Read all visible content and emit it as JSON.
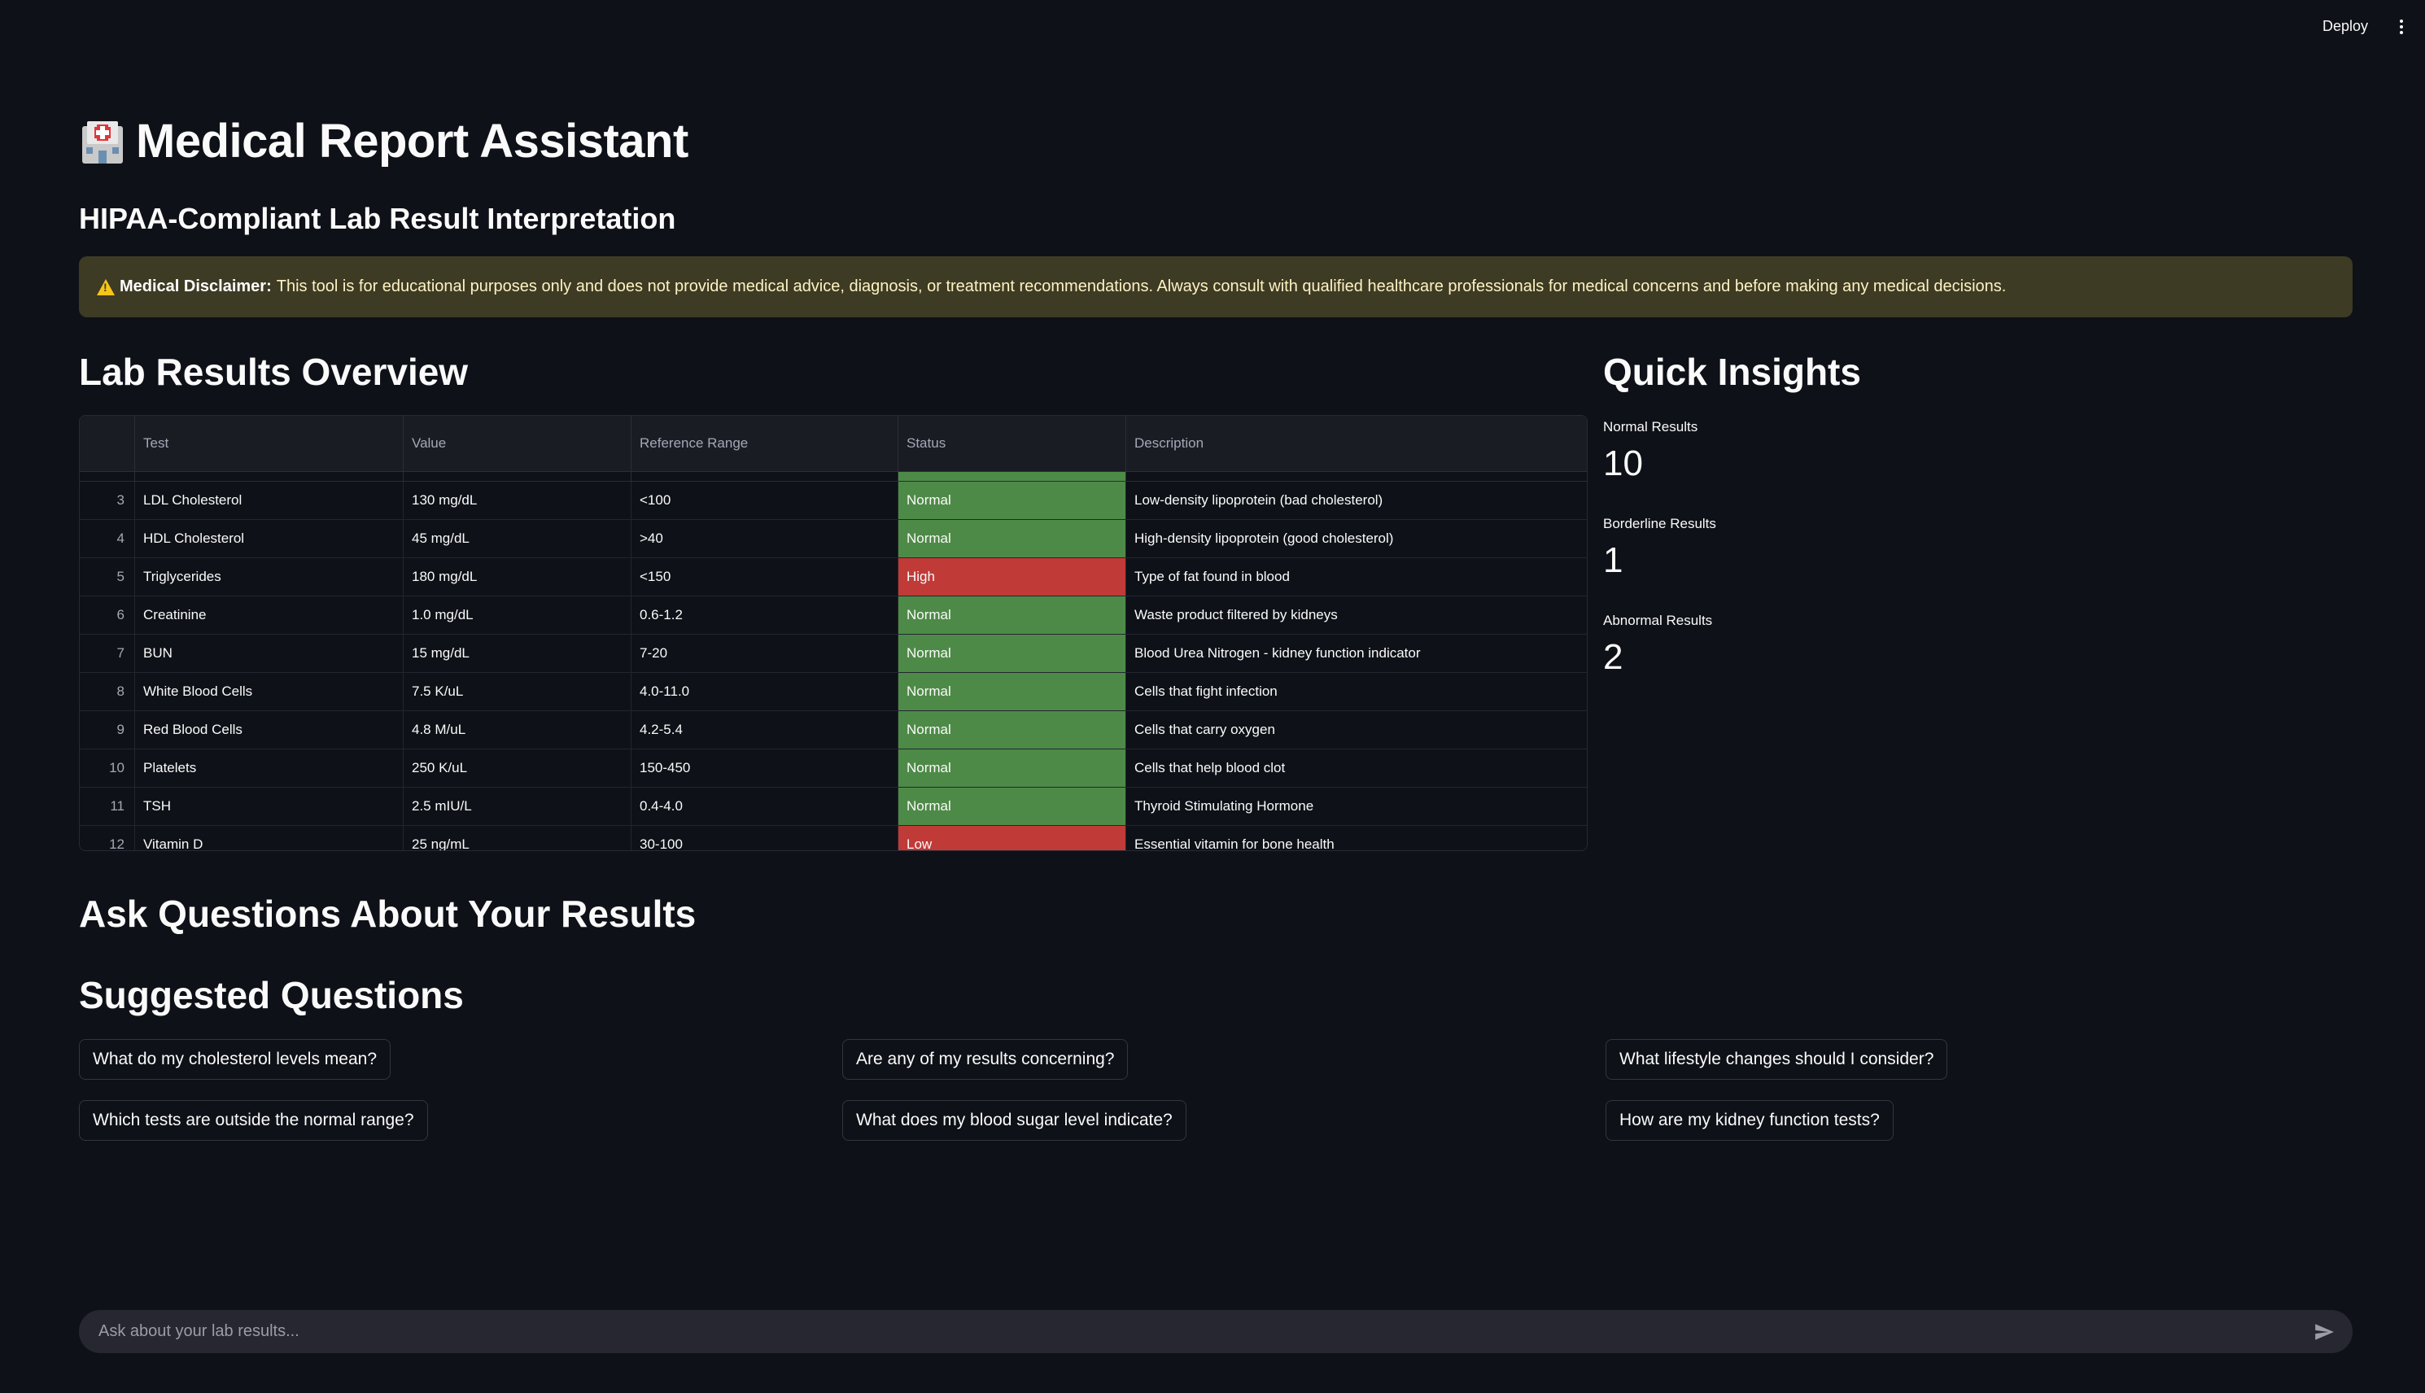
{
  "header": {
    "deploy_label": "Deploy",
    "menu_icon": "kebab-menu-icon"
  },
  "page": {
    "title": "Medical Report Assistant",
    "title_icon": "hospital-icon",
    "subtitle": "HIPAA-Compliant Lab Result Interpretation"
  },
  "disclaimer": {
    "icon": "warning-icon",
    "label": "Medical Disclaimer:",
    "text": "This tool is for educational purposes only and does not provide medical advice, diagnosis, or treatment recommendations. Always consult with qualified healthcare professionals for medical concerns and before making any medical decisions."
  },
  "lab_results": {
    "heading": "Lab Results Overview",
    "columns": [
      "",
      "Test",
      "Value",
      "Reference Range",
      "Status",
      "Description"
    ],
    "rows": [
      {
        "index": "3",
        "test": "LDL Cholesterol",
        "value": "130 mg/dL",
        "range": "<100",
        "status": "Normal",
        "description": "Low-density lipoprotein (bad cholesterol)"
      },
      {
        "index": "4",
        "test": "HDL Cholesterol",
        "value": "45 mg/dL",
        "range": ">40",
        "status": "Normal",
        "description": "High-density lipoprotein (good cholesterol)"
      },
      {
        "index": "5",
        "test": "Triglycerides",
        "value": "180 mg/dL",
        "range": "<150",
        "status": "High",
        "description": "Type of fat found in blood"
      },
      {
        "index": "6",
        "test": "Creatinine",
        "value": "1.0 mg/dL",
        "range": "0.6-1.2",
        "status": "Normal",
        "description": "Waste product filtered by kidneys"
      },
      {
        "index": "7",
        "test": "BUN",
        "value": "15 mg/dL",
        "range": "7-20",
        "status": "Normal",
        "description": "Blood Urea Nitrogen - kidney function indicator"
      },
      {
        "index": "8",
        "test": "White Blood Cells",
        "value": "7.5 K/uL",
        "range": "4.0-11.0",
        "status": "Normal",
        "description": "Cells that fight infection"
      },
      {
        "index": "9",
        "test": "Red Blood Cells",
        "value": "4.8 M/uL",
        "range": "4.2-5.4",
        "status": "Normal",
        "description": "Cells that carry oxygen"
      },
      {
        "index": "10",
        "test": "Platelets",
        "value": "250 K/uL",
        "range": "150-450",
        "status": "Normal",
        "description": "Cells that help blood clot"
      },
      {
        "index": "11",
        "test": "TSH",
        "value": "2.5 mIU/L",
        "range": "0.4-4.0",
        "status": "Normal",
        "description": "Thyroid Stimulating Hormone"
      },
      {
        "index": "12",
        "test": "Vitamin D",
        "value": "25 ng/mL",
        "range": "30-100",
        "status": "Low",
        "description": "Essential vitamin for bone health"
      }
    ]
  },
  "insights": {
    "heading": "Quick Insights",
    "metrics": [
      {
        "label": "Normal Results",
        "value": "10"
      },
      {
        "label": "Borderline Results",
        "value": "1"
      },
      {
        "label": "Abnormal Results",
        "value": "2"
      }
    ]
  },
  "questions": {
    "heading": "Ask Questions About Your Results",
    "suggested_heading": "Suggested Questions",
    "items": [
      "What do my cholesterol levels mean?",
      "Are any of my results concerning?",
      "What lifestyle changes should I consider?",
      "Which tests are outside the normal range?",
      "What does my blood sugar level indicate?",
      "How are my kidney function tests?"
    ]
  },
  "chat": {
    "placeholder": "Ask about your lab results...",
    "send_icon": "send-icon"
  },
  "colors": {
    "background": "#0e1117",
    "status_normal": "#4e8a47",
    "status_abnormal": "#c03a38",
    "disclaimer_bg": "#3e3b24"
  }
}
